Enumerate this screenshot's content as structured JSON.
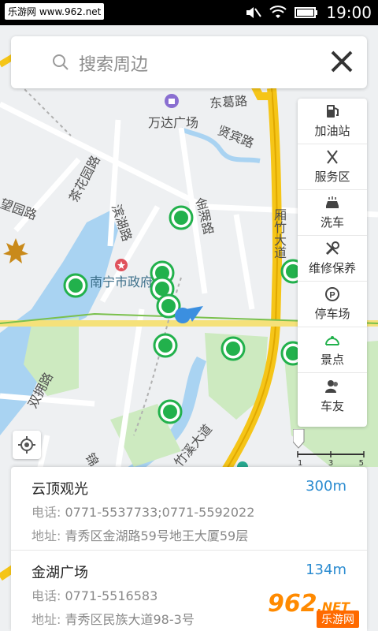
{
  "status_bar": {
    "watermark": "乐游网 www.962.net",
    "time": "19:00"
  },
  "search": {
    "placeholder": "搜索周边"
  },
  "map": {
    "labels": [
      {
        "id": "road-donggelu",
        "text": "东葛路"
      },
      {
        "id": "poi-wanda",
        "text": "万达广场"
      },
      {
        "id": "road-xianbinlu",
        "text": "贤宾路"
      },
      {
        "id": "road-chahuayuanlu",
        "text": "茶花园路"
      },
      {
        "id": "road-wangyuanlu",
        "text": "望园路"
      },
      {
        "id": "road-binhulu",
        "text": "滨湖路"
      },
      {
        "id": "road-jinhulu",
        "text": "金湖路"
      },
      {
        "id": "road-xiangzhudadao",
        "text": "厢竹大道"
      },
      {
        "id": "poi-nanning-gov",
        "text": "南宁市政府"
      },
      {
        "id": "road-shuangyonglu",
        "text": "双拥路"
      },
      {
        "id": "road-zhuxidadao",
        "text": "竹溪大道"
      },
      {
        "id": "road-jin",
        "text": "锦"
      }
    ]
  },
  "poi_categories": [
    {
      "label": "加油站",
      "icon": "gas-station-icon"
    },
    {
      "label": "服务区",
      "icon": "service-area-icon"
    },
    {
      "label": "洗车",
      "icon": "car-wash-icon"
    },
    {
      "label": "维修保养",
      "icon": "repair-icon"
    },
    {
      "label": "停车场",
      "icon": "parking-icon"
    },
    {
      "label": "景点",
      "icon": "scenic-spot-icon"
    },
    {
      "label": "车友",
      "icon": "car-friends-icon"
    }
  ],
  "scale": {
    "ticks": [
      "1",
      "3",
      "5"
    ]
  },
  "results": [
    {
      "name": "云顶观光",
      "distance": "300m",
      "phone_key": "电话:",
      "phone": "0771-5537733;0771-5592022",
      "address_key": "地址:",
      "address": "青秀区金湖路59号地王大厦59层"
    },
    {
      "name": "金湖广场",
      "distance": "134m",
      "phone_key": "电话:",
      "phone": "0771-5516583",
      "address_key": "地址:",
      "address": "青秀区民族大道98-3号"
    }
  ],
  "logo": {
    "big": "962",
    "suffix": ".NET",
    "small": "乐游网"
  },
  "colors": {
    "accent_blue": "#2a8bd0",
    "marker_green": "#22b14c",
    "road_yellow": "#f5c518",
    "water_blue": "#a9d3f2",
    "park_green": "#cdeac0"
  }
}
